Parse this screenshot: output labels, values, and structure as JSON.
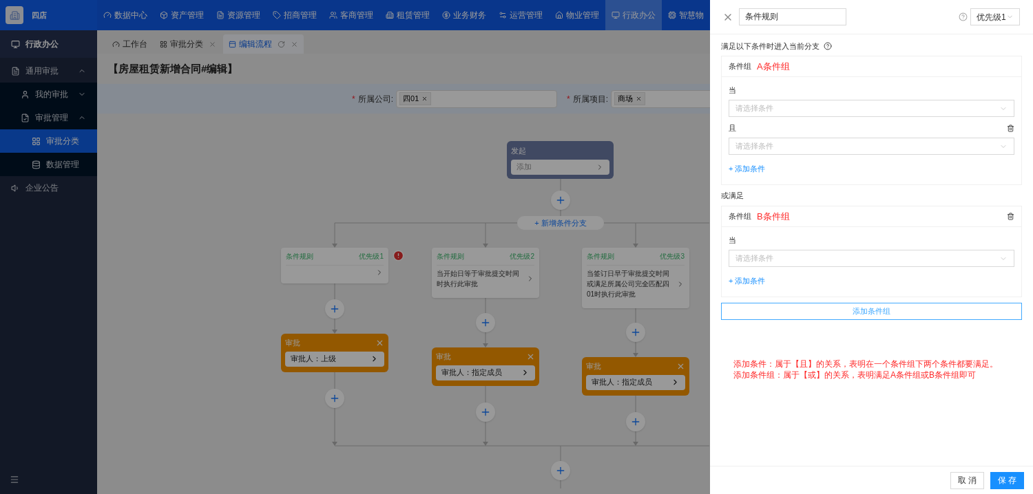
{
  "top_nav": {
    "logo_text": "四店",
    "items": [
      {
        "label": "数据中心",
        "selected": false
      },
      {
        "label": "资产管理",
        "selected": false
      },
      {
        "label": "资源管理",
        "selected": false
      },
      {
        "label": "招商管理",
        "selected": false
      },
      {
        "label": "客商管理",
        "selected": false
      },
      {
        "label": "租赁管理",
        "selected": false
      },
      {
        "label": "业务财务",
        "selected": false
      },
      {
        "label": "运营管理",
        "selected": false
      },
      {
        "label": "物业管理",
        "selected": false
      },
      {
        "label": "行政办公",
        "selected": true
      },
      {
        "label": "智慧物",
        "selected": false
      }
    ]
  },
  "sidebar": {
    "title": "行政办公",
    "items": [
      {
        "label": "通用审批",
        "expanded": true,
        "selected": false,
        "children": [
          {
            "label": "我的审批",
            "expanded": false,
            "selected": false
          },
          {
            "label": "审批管理",
            "expanded": true,
            "selected": false,
            "children": [
              {
                "label": "审批分类",
                "selected": true
              },
              {
                "label": "数据管理",
                "selected": false
              }
            ]
          }
        ]
      },
      {
        "label": "企业公告",
        "selected": false
      }
    ]
  },
  "tabs": [
    {
      "label": "工作台",
      "selected": false,
      "closable": false,
      "refresh": false
    },
    {
      "label": "审批分类",
      "selected": false,
      "closable": true,
      "refresh": false
    },
    {
      "label": "编辑流程",
      "selected": true,
      "closable": true,
      "refresh": true
    }
  ],
  "page_title": "【房屋租赁新增合同#编辑】",
  "filters": [
    {
      "required_mark": "*",
      "label": "所属公司:",
      "tag": "四01"
    },
    {
      "required_mark": "*",
      "label": "所属项目:",
      "tag": "商场"
    }
  ],
  "flow": {
    "start": {
      "title": "发起",
      "action": "添加"
    },
    "add_branch": "+ 新增条件分支",
    "branches": [
      {
        "title": "条件规则",
        "priority": "优先级1",
        "error": true,
        "approval": {
          "title": "审批",
          "approver": "审批人：上级"
        }
      },
      {
        "title": "条件规则",
        "priority": "优先级2",
        "text": "当开始日等于审批提交时间时执行此审批",
        "error": false,
        "approval": {
          "title": "审批",
          "approver": "审批人：指定成员"
        }
      },
      {
        "title": "条件规则",
        "priority": "优先级3",
        "text": "当签订日早于审批提交时间或满足所属公司完全匹配四01时执行此审批",
        "error": false,
        "approval": {
          "title": "审批",
          "approver": "审批人：指定成员"
        }
      }
    ]
  },
  "drawer": {
    "title_value": "条件规则",
    "priority": "优先级1",
    "intro": "满足以下条件时进入当前分支",
    "or_label": "或满足",
    "groups": [
      {
        "label": "条件组",
        "name": "A条件组",
        "deletable": false,
        "add_label": "+ 添加条件",
        "conditions": [
          {
            "connector": "当",
            "placeholder": "请选择条件",
            "deletable": false
          },
          {
            "connector": "且",
            "placeholder": "请选择条件",
            "deletable": true
          }
        ]
      },
      {
        "label": "条件组",
        "name": "B条件组",
        "deletable": true,
        "add_label": "+ 添加条件",
        "conditions": [
          {
            "connector": "当",
            "placeholder": "请选择条件",
            "deletable": false
          }
        ]
      }
    ],
    "add_group": "添加条件组",
    "notes": [
      "添加条件：属于【且】的关系，表明在一个条件组下两个条件都要满足。",
      "添加条件组：属于【或】的关系，表明满足A条件组或B条件组即可"
    ],
    "buttons": [
      {
        "label": "取 消",
        "kind": "secondary"
      },
      {
        "label": "保 存",
        "kind": "primary"
      }
    ]
  }
}
